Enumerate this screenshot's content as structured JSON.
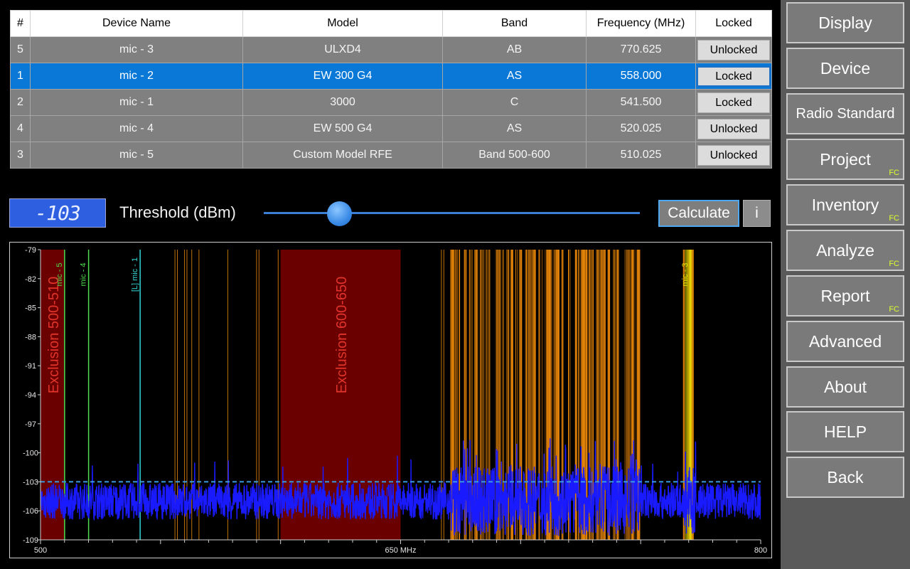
{
  "table": {
    "headers": [
      "#",
      "Device Name",
      "Model",
      "Band",
      "Frequency (MHz)",
      "Locked"
    ],
    "rows": [
      {
        "num": "5",
        "name": "mic - 3",
        "model": "ULXD4",
        "band": "AB",
        "freq": "770.625",
        "locked": "Unlocked",
        "selected": false
      },
      {
        "num": "1",
        "name": "mic - 2",
        "model": "EW 300 G4",
        "band": "AS",
        "freq": "558.000",
        "locked": "Locked",
        "selected": true
      },
      {
        "num": "2",
        "name": "mic - 1",
        "model": "3000",
        "band": "C",
        "freq": "541.500",
        "locked": "Locked",
        "selected": false
      },
      {
        "num": "4",
        "name": "mic - 4",
        "model": "EW 500 G4",
        "band": "AS",
        "freq": "520.025",
        "locked": "Unlocked",
        "selected": false
      },
      {
        "num": "3",
        "name": "mic - 5",
        "model": "Custom Model RFE",
        "band": "Band 500-600",
        "freq": "510.025",
        "locked": "Unlocked",
        "selected": false
      }
    ]
  },
  "threshold": {
    "value_display": "-103",
    "label": "Threshold (dBm)",
    "slider_value": -103,
    "calculate_label": "Calculate",
    "info_label": "i"
  },
  "menu": {
    "items": [
      {
        "label": "Display",
        "fc": ""
      },
      {
        "label": "Device",
        "fc": ""
      },
      {
        "label": "Radio Standard",
        "fc": ""
      },
      {
        "label": "Project",
        "fc": "FC"
      },
      {
        "label": "Inventory",
        "fc": "FC"
      },
      {
        "label": "Analyze",
        "fc": "FC"
      },
      {
        "label": "Report",
        "fc": "FC"
      },
      {
        "label": "Advanced",
        "fc": ""
      },
      {
        "label": "About",
        "fc": ""
      },
      {
        "label": "HELP",
        "fc": ""
      },
      {
        "label": "Back",
        "fc": ""
      }
    ]
  },
  "colors": {
    "exclusion": "#6b0000",
    "exclusion_text": "#e0342a",
    "interference": "#e8860a",
    "signal": "#1a1aff",
    "threshold_line": "#3a9ae0",
    "mic_green": "#4dde4d",
    "mic_cyan": "#33d6d6",
    "mic_yellow": "#e6e600",
    "fc_tag": "#e0ff2a"
  },
  "chart_data": {
    "type": "line",
    "xlim": [
      500,
      800
    ],
    "ylim": [
      -109,
      -79
    ],
    "yticks": [
      -79,
      -82,
      -85,
      -88,
      -91,
      -94,
      -97,
      -100,
      -103,
      -106,
      -109
    ],
    "xtick_labels": [
      {
        "value": 500,
        "label": "500"
      },
      {
        "value": 650,
        "label": "650 MHz"
      },
      {
        "value": 800,
        "label": "800"
      }
    ],
    "threshold_dbm": -103,
    "exclusions": [
      {
        "from": 500,
        "to": 510,
        "label": "Exclusion 500-510"
      },
      {
        "from": 600,
        "to": 650,
        "label": "Exclusion 600-650"
      }
    ],
    "mics": [
      {
        "freq": 510.025,
        "label": "mic - 5",
        "color": "green"
      },
      {
        "freq": 520.025,
        "label": "mic - 4",
        "color": "green"
      },
      {
        "freq": 541.5,
        "label": "[L] mic - 1",
        "color": "cyan"
      },
      {
        "freq": 770.625,
        "label": "mic - 3",
        "color": "yellow"
      }
    ],
    "interference_regions": [
      {
        "from": 671,
        "to": 750
      },
      {
        "from": 768,
        "to": 773
      }
    ],
    "noise_floor_dbm": -105
  }
}
